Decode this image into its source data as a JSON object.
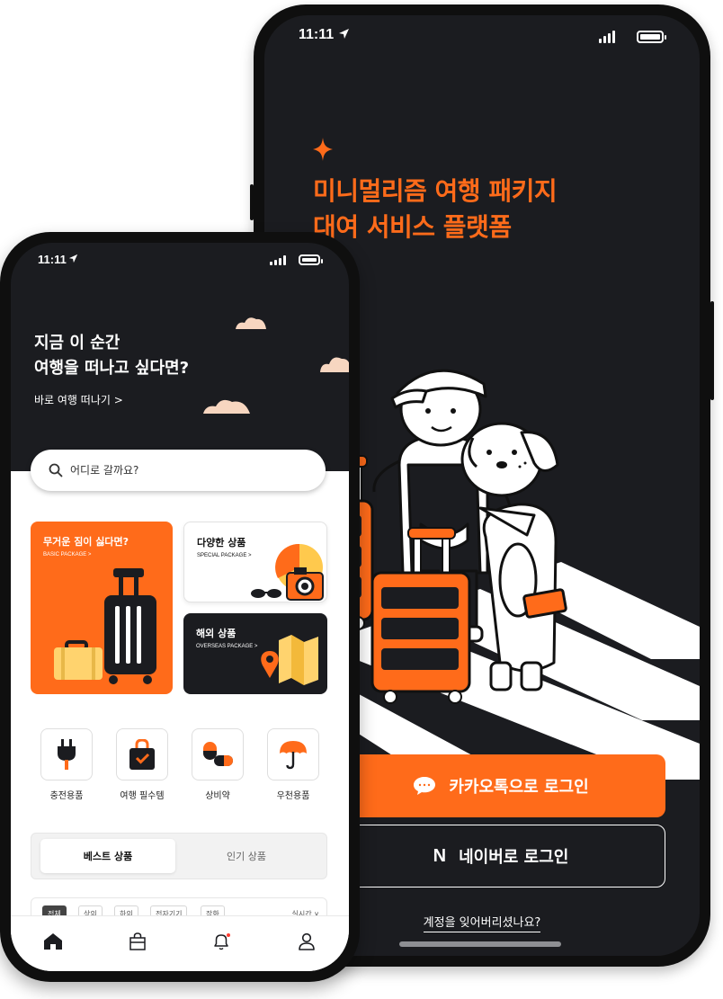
{
  "login_screen": {
    "status": {
      "time": "11:11"
    },
    "headline_line1": "미니멀리즘 여행 패키지",
    "headline_line2": "대여 서비스 플랫폼",
    "kakao_login_label": "카카오톡으로 로그인",
    "naver_login_label": "네이버로 로그인",
    "naver_logo": "N",
    "forgot_account_label": "계정을 잊어버리셨나요?",
    "colors": {
      "accent": "#ff6b1a",
      "background": "#1b1c20"
    }
  },
  "home_screen": {
    "status": {
      "time": "11:11"
    },
    "hero": {
      "title_line1": "지금 이 순간",
      "title_line2": "여행을 떠나고 싶다면?",
      "link": "바로 여행 떠나기 >"
    },
    "search": {
      "placeholder": "어디로 갈까요?"
    },
    "cards": {
      "basic": {
        "title": "무거운 짐이 싫다면?",
        "subtitle": "BASIC PACKAGE >"
      },
      "special": {
        "title": "다양한 상품",
        "subtitle": "SPECIAL PACKAGE >"
      },
      "overseas": {
        "title": "해외 상품",
        "subtitle": "OVERSEAS PACKAGE >"
      }
    },
    "categories": [
      {
        "label": "충전용품",
        "icon": "plug-icon"
      },
      {
        "label": "여행 필수템",
        "icon": "bag-check-icon"
      },
      {
        "label": "상비약",
        "icon": "pill-icon"
      },
      {
        "label": "우천용품",
        "icon": "umbrella-icon"
      }
    ],
    "tabs": {
      "best": "베스트 상품",
      "popular": "인기 상품"
    },
    "filters": [
      "전체",
      "상의",
      "하의",
      "전자기기",
      "잡화"
    ],
    "realtime_label": "실시간 ∨",
    "bottom_nav": [
      "home-icon",
      "shopping-bag-icon",
      "bell-icon",
      "user-icon"
    ]
  }
}
